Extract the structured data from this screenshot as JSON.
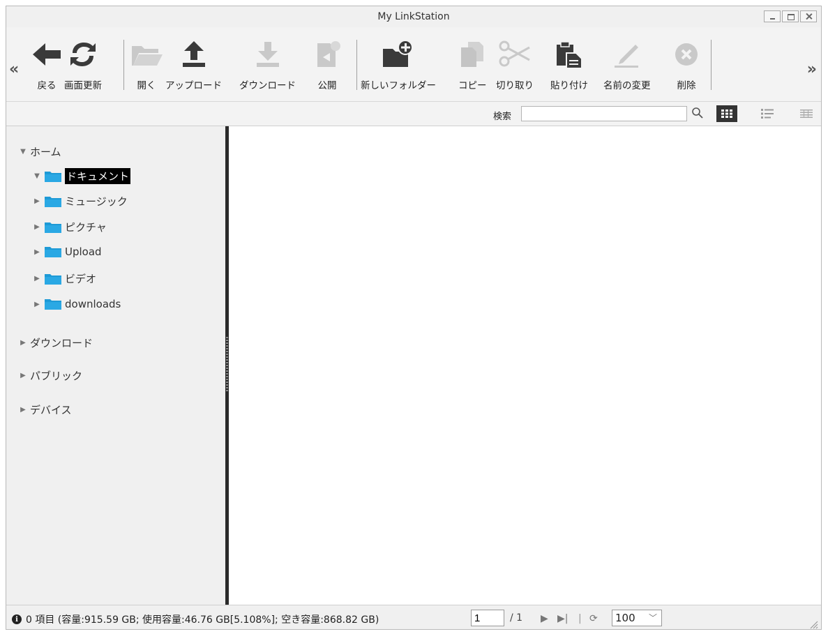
{
  "window": {
    "title": "My LinkStation"
  },
  "toolbar": {
    "buttons": [
      {
        "label": "戻る",
        "icon": "back-arrow-icon",
        "enabled": true
      },
      {
        "label": "画面更新",
        "icon": "refresh-icon",
        "enabled": true
      },
      {
        "label": "開く",
        "icon": "open-folder-icon",
        "enabled": false
      },
      {
        "label": "アップロード",
        "icon": "upload-icon",
        "enabled": true
      },
      {
        "label": "ダウンロード",
        "icon": "download-icon",
        "enabled": false
      },
      {
        "label": "公開",
        "icon": "publish-icon",
        "enabled": false
      },
      {
        "label": "新しいフォルダー",
        "icon": "new-folder-icon",
        "enabled": true
      },
      {
        "label": "コピー",
        "icon": "copy-icon",
        "enabled": false
      },
      {
        "label": "切り取り",
        "icon": "cut-icon",
        "enabled": false
      },
      {
        "label": "貼り付け",
        "icon": "paste-icon",
        "enabled": true
      },
      {
        "label": "名前の変更",
        "icon": "rename-icon",
        "enabled": false
      },
      {
        "label": "削除",
        "icon": "delete-icon",
        "enabled": false
      }
    ]
  },
  "search": {
    "label": "検索",
    "value": ""
  },
  "tree": {
    "home": {
      "label": "ホーム",
      "children": [
        {
          "label": "ドキュメント",
          "selected": true
        },
        {
          "label": "ミュージック",
          "selected": false
        },
        {
          "label": "ピクチャ",
          "selected": false
        },
        {
          "label": "Upload",
          "selected": false
        },
        {
          "label": "ビデオ",
          "selected": false
        },
        {
          "label": "downloads",
          "selected": false
        }
      ]
    },
    "roots": [
      {
        "label": "ダウンロード"
      },
      {
        "label": "パブリック"
      },
      {
        "label": "デバイス"
      }
    ]
  },
  "status": {
    "info_text": "0 項目 (容量:915.59 GB; 使用容量:46.76 GB[5.108%]; 空き容量:868.82 GB)",
    "page_value": "1",
    "page_total": "/ 1",
    "per_page": "100"
  },
  "colors": {
    "folder_blue": "#1e9ad6",
    "enabled_icon": "#3a3a3a",
    "disabled_icon": "#c9c9c9"
  }
}
